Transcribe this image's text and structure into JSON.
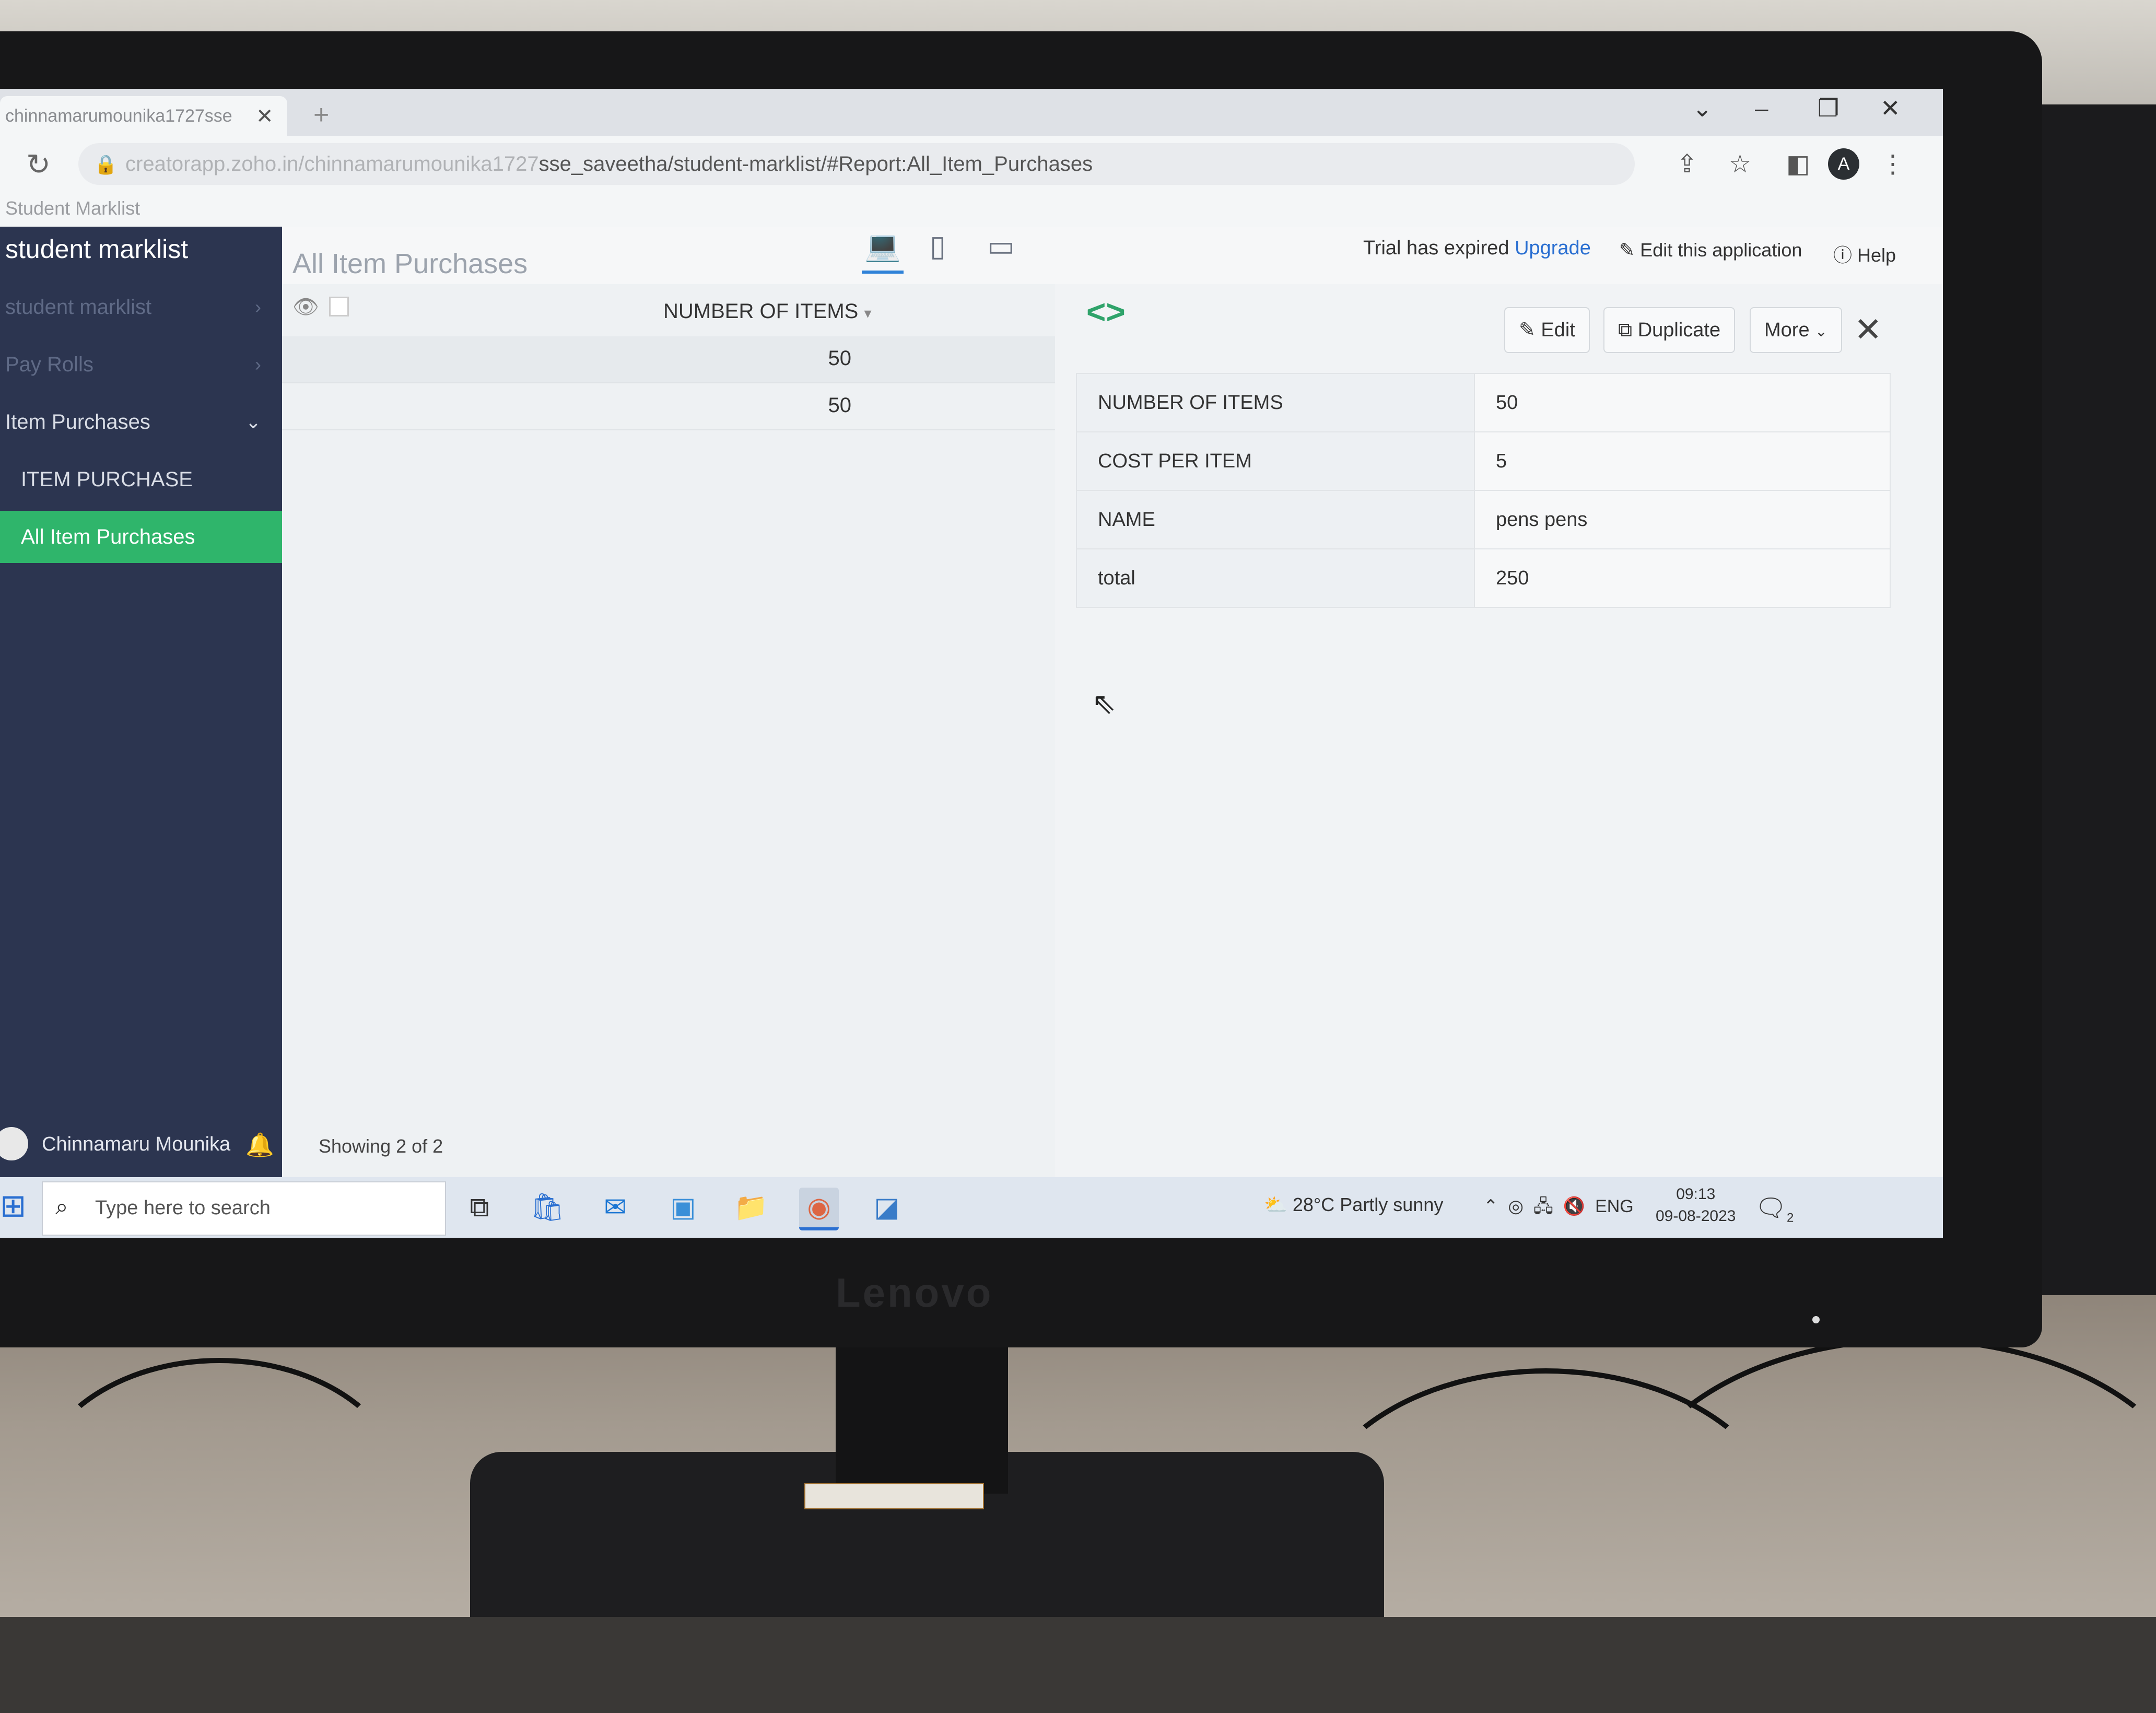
{
  "browser": {
    "tab_title": "chinnamarumounika1727sse",
    "url_prefix": "creatorapp.zoho.in/chinnamarumounika1727",
    "url_main": "sse_saveetha/student-marklist/#Report:All_Item_Purchases",
    "bookmark": "Student Marklist",
    "profile_initial": "A"
  },
  "sidebar": {
    "app_name": "student marklist",
    "items": [
      {
        "label": "student marklist"
      },
      {
        "label": "Pay Rolls"
      },
      {
        "label": "Item Purchases"
      },
      {
        "label": "ITEM PURCHASE"
      },
      {
        "label": "All Item Purchases"
      }
    ],
    "user_name": "Chinnamaru Mounika"
  },
  "header": {
    "page_title": "All Item Purchases",
    "trial_text": "Trial has expired",
    "upgrade_label": "Upgrade",
    "edit_app_label": "Edit this application",
    "help_label": "Help"
  },
  "list": {
    "column_header": "NUMBER OF ITEMS",
    "rows": [
      "50",
      "50"
    ],
    "showing": "Showing 2 of 2"
  },
  "detail": {
    "edit_label": "Edit",
    "duplicate_label": "Duplicate",
    "more_label": "More",
    "fields": [
      {
        "label": "NUMBER OF ITEMS",
        "value": "50"
      },
      {
        "label": "COST PER ITEM",
        "value": "5"
      },
      {
        "label": "NAME",
        "value": "pens pens"
      },
      {
        "label": "total",
        "value": "250"
      }
    ]
  },
  "taskbar": {
    "search_placeholder": "Type here to search",
    "weather": "28°C  Partly sunny",
    "language": "ENG",
    "time": "09:13",
    "date": "09-08-2023",
    "notification_count": "2"
  },
  "hardware": {
    "monitor_brand": "Lenovo"
  },
  "colors": {
    "sidebar_bg": "#2c3550",
    "active_item": "#2fb56b",
    "link": "#2a6fd1"
  }
}
